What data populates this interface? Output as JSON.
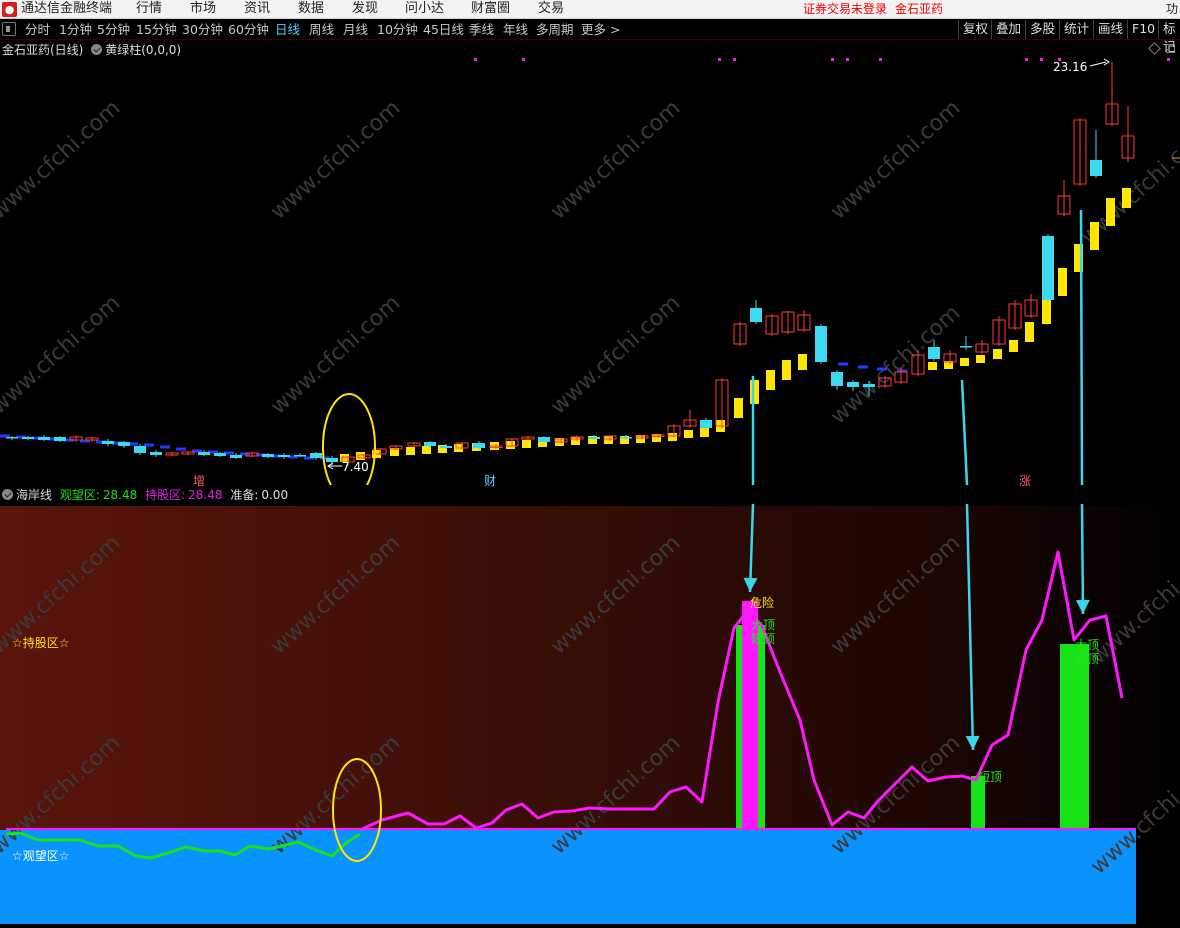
{
  "app": {
    "title": "通达信金融终端",
    "menu": [
      "行情",
      "市场",
      "资讯",
      "数据",
      "发现",
      "问小达",
      "财富圈",
      "交易"
    ],
    "status": "证券交易未登录",
    "stock": "金石亚药",
    "edge_label": "功"
  },
  "periods": [
    "分时",
    "1分钟",
    "5分钟",
    "15分钟",
    "30分钟",
    "60分钟",
    "日线",
    "周线",
    "月线",
    "10分钟",
    "45日线",
    "季线",
    "年线",
    "多周期",
    "更多 >"
  ],
  "active_period": "日线",
  "tools": [
    "复权",
    "叠加",
    "多股",
    "统计",
    "画线",
    "F10",
    "标记"
  ],
  "main_chart": {
    "title": "金石亚药(日线)",
    "indicator": "黄绿柱(0,0,0)",
    "low_label": "7.40",
    "high_label": "23.16",
    "markers": [
      "增",
      "财",
      "涨"
    ]
  },
  "sub_chart": {
    "name": "海岸线",
    "fields": [
      {
        "label": "观望区:",
        "value": "28.48",
        "color": "#19e019"
      },
      {
        "label": "持股区:",
        "value": "28.48",
        "color": "#e020e0"
      },
      {
        "label": "准备:",
        "value": "0.00",
        "color": "#dddddd"
      }
    ],
    "zone_hold": "☆持股区☆",
    "zone_watch": "☆观望区☆",
    "signals": [
      "危险",
      "大顶",
      "短顶",
      "短顶",
      "大顶",
      "短顶"
    ]
  },
  "watermark": "www.cfchi.com",
  "colors": {
    "up": "#ff3b3b",
    "down": "#3dd9ee",
    "yellow": "#ffe600",
    "blue_line": "#1f3cff",
    "magenta": "#ff18ff",
    "green": "#16e216",
    "zone_blue": "#0a93ff"
  }
}
